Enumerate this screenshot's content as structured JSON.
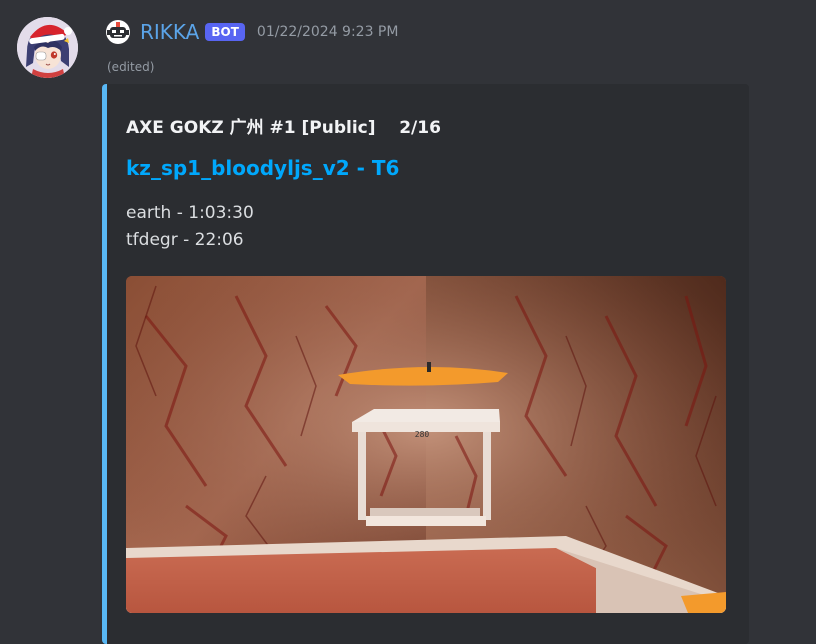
{
  "message": {
    "author": "RIKKA",
    "bot_tag": "BOT",
    "timestamp": "01/22/2024 9:23 PM",
    "edited": "(edited)",
    "avatar_icon": "anime-girl-santa-hat-avatar",
    "author_icon": "robot-icon"
  },
  "embed": {
    "accent_color": "#59b8f5",
    "title": "AXE GOKZ 广州 #1 [Public]    2/16",
    "link": "kz_sp1_bloodyljs_v2 - T6",
    "lines": [
      "earth - 1:03:30",
      "tfdegr - 22:06"
    ],
    "image_text": "280"
  },
  "colors": {
    "background": "#313338",
    "embed_bg": "#2b2d31",
    "username": "#5ba4e8",
    "link": "#00a8fc",
    "bot_tag": "#5865f2"
  }
}
